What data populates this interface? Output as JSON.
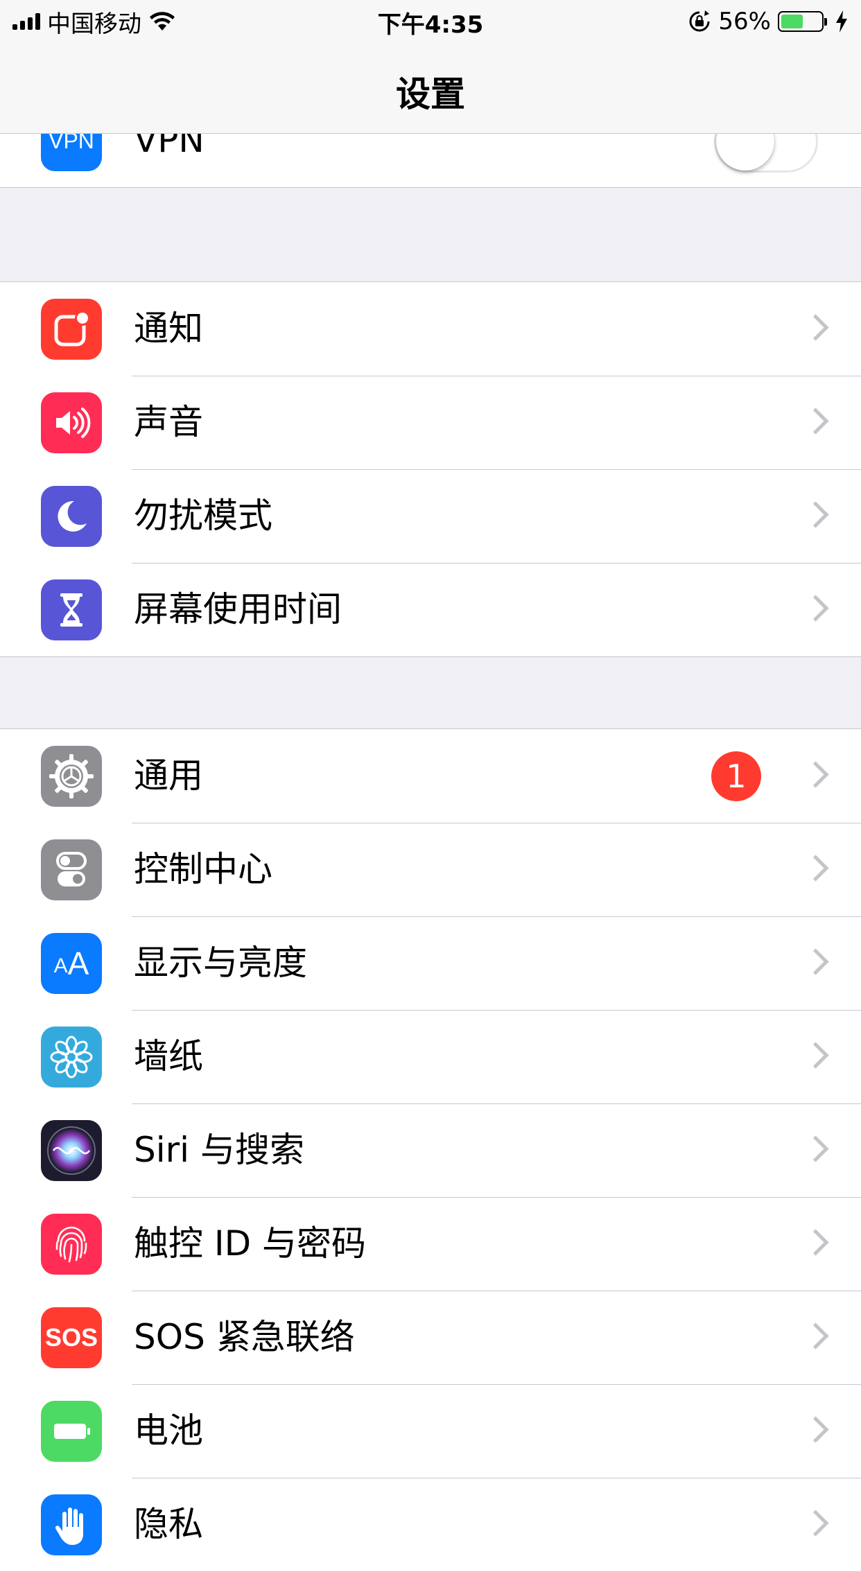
{
  "status_bar": {
    "carrier": "中国移动",
    "time": "下午4:35",
    "battery_percent": "56%",
    "battery_level": 0.56,
    "icons": [
      "signal-icon",
      "wifi-icon",
      "rotation-lock-icon",
      "battery-icon",
      "charging-icon"
    ]
  },
  "nav": {
    "title": "设置"
  },
  "colors": {
    "vpn": "#0a7aff",
    "notifications": "#ff3b30",
    "sounds": "#ff2d55",
    "dnd": "#5856d6",
    "screen_time": "#5856d6",
    "general": "#8e8e93",
    "control_center": "#8e8e93",
    "display": "#0a7aff",
    "wallpaper": "#34aadc",
    "siri": "#1c1c2e",
    "touch_id": "#ff2d55",
    "sos": "#ff3b30",
    "battery": "#4cd964",
    "privacy": "#0a7aff",
    "toggle_off": "#e5e5ea",
    "badge": "#ff3b30"
  },
  "sections": {
    "vpn": {
      "icon_text": "VPN",
      "label": "VPN",
      "toggle_on": false
    },
    "group1": {
      "items": [
        {
          "label": "通知",
          "icon": "notifications-icon"
        },
        {
          "label": "声音",
          "icon": "speaker-icon"
        },
        {
          "label": "勿扰模式",
          "icon": "moon-icon"
        },
        {
          "label": "屏幕使用时间",
          "icon": "hourglass-icon"
        }
      ]
    },
    "group2": {
      "items": [
        {
          "label": "通用",
          "icon": "gear-icon",
          "badge": "1"
        },
        {
          "label": "控制中心",
          "icon": "switches-icon"
        },
        {
          "label": "显示与亮度",
          "icon": "text-size-icon",
          "icon_text": "AA"
        },
        {
          "label": "墙纸",
          "icon": "flower-icon"
        },
        {
          "label": "Siri 与搜索",
          "icon": "siri-icon"
        },
        {
          "label": "触控 ID 与密码",
          "icon": "fingerprint-icon"
        },
        {
          "label": "SOS 紧急联络",
          "icon": "sos-icon",
          "icon_text": "SOS"
        },
        {
          "label": "电池",
          "icon": "battery-icon"
        },
        {
          "label": "隐私",
          "icon": "hand-icon"
        }
      ]
    }
  }
}
